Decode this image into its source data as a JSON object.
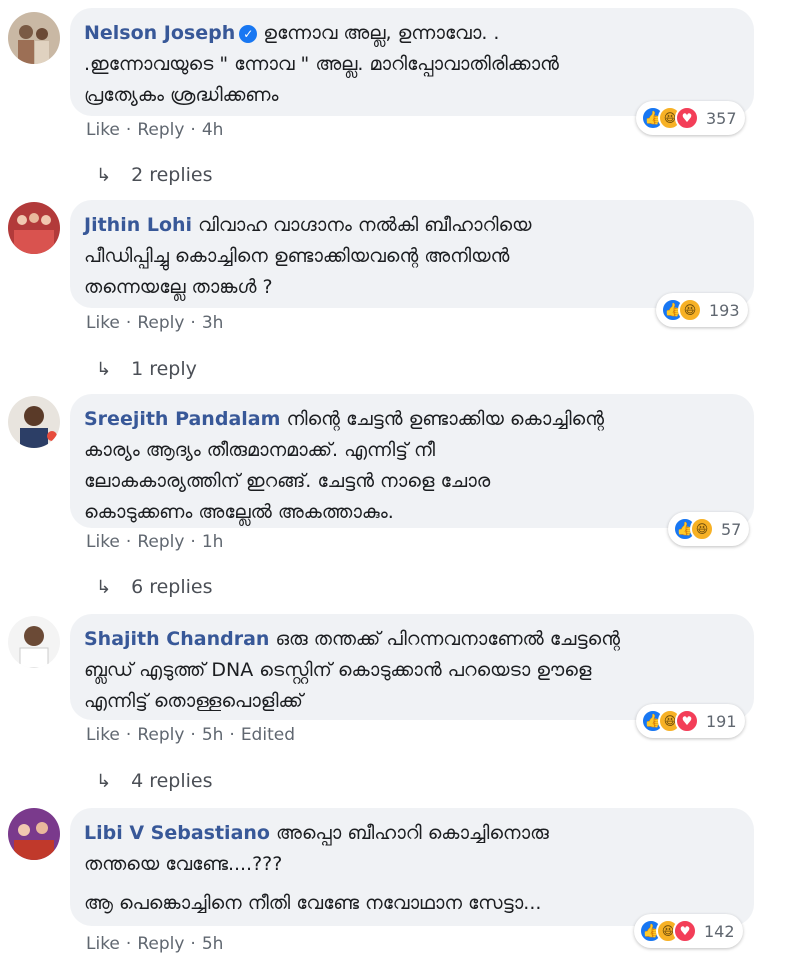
{
  "comments": [
    {
      "author": "Nelson Joseph",
      "verified": true,
      "lines": [
        "ഉന്നോവ അല്ല, ഉന്നാവോ. .",
        ".ഇന്നോവയുടെ \" ന്നോവ \" അല്ല. മാറിപ്പോവാതിരിക്കാൻ",
        "പ്രത്യേകം ശ്രദ്ധിക്കണം"
      ],
      "like": "Like",
      "reply": "Reply",
      "time": "4h",
      "reactions": [
        "like-icon",
        "haha-icon",
        "love-icon"
      ],
      "count": "357",
      "replies": "2 replies"
    },
    {
      "author": "Jithin Lohi",
      "lines": [
        "വിവാഹ വാഗ്ദാനം നൽകി ബീഹാറിയെ",
        "പീഡിപ്പിച്ചു കൊച്ചിനെ ഉണ്ടാക്കിയവന്റെ അനിയൻ",
        "തന്നെയല്ലേ താങ്കൾ ?"
      ],
      "like": "Like",
      "reply": "Reply",
      "time": "3h",
      "reactions": [
        "like-icon",
        "haha-icon"
      ],
      "count": "193",
      "replies": "1 reply"
    },
    {
      "author": "Sreejith Pandalam",
      "lines": [
        "നിന്റെ ചേട്ടൻ ഉണ്ടാക്കിയ കൊച്ചിന്റെ",
        "കാര്യം ആദ്യം തീരുമാനമാക്ക്. എന്നിട്ട് നീ",
        "ലോകകാര്യത്തിന് ഇറങ്ങ്. ചേട്ടൻ നാളെ ചോര",
        "കൊടുക്കണം അല്ലേൽ അകത്താകും."
      ],
      "like": "Like",
      "reply": "Reply",
      "time": "1h",
      "reactions": [
        "like-icon",
        "haha-icon"
      ],
      "count": "57",
      "replies": "6 replies"
    },
    {
      "author": "Shajith Chandran",
      "lines": [
        "ഒരു തന്തക്ക് പിറന്നവനാണേൽ ചേട്ടന്റെ",
        "ബ്ലഡ് എടുത്ത് DNA ടെസ്റ്റിന് കൊടുക്കാൻ പറയെടാ ഊളെ",
        "എന്നിട്ട് തൊള്ളപൊളിക്ക്"
      ],
      "like": "Like",
      "reply": "Reply",
      "time": "5h",
      "edited": "Edited",
      "reactions": [
        "like-icon",
        "haha-icon",
        "love-icon"
      ],
      "count": "191",
      "replies": "4 replies"
    },
    {
      "author": "Libi V Sebastiano",
      "lines": [
        "അപ്പൊ ബീഹാറി കൊച്ചിനൊരു",
        "തന്തയെ വേണ്ടേ....???",
        "ആ പെങ്കൊച്ചിനെ നീതി വേണ്ടേ നവോഥാന സേട്ടാ..."
      ],
      "like": "Like",
      "reply": "Reply",
      "time": "5h",
      "reactions": [
        "like-icon",
        "haha-icon",
        "love-icon"
      ],
      "count": "142"
    }
  ],
  "colors": {
    "author": "#385898",
    "bubble": "#f0f2f5",
    "meta": "#606770",
    "like": "#1877f2",
    "haha": "#f7b125",
    "love": "#f33e58"
  }
}
